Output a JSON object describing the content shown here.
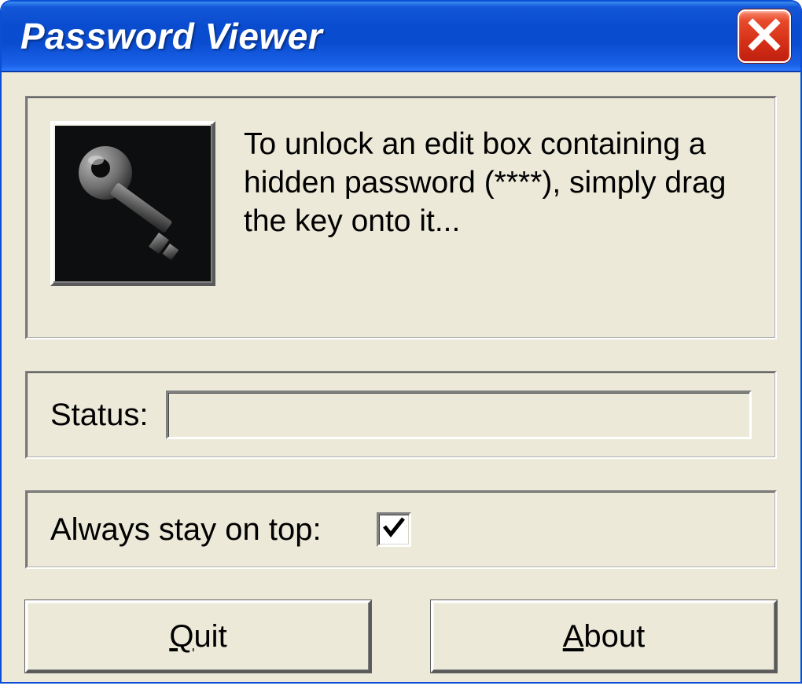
{
  "window": {
    "title": "Password Viewer"
  },
  "instruction": {
    "text": "To unlock an edit box containing a hidden password (****), simply drag the key onto it..."
  },
  "status": {
    "label": "Status:",
    "value": ""
  },
  "ontop": {
    "label": "Always stay on top:",
    "checked": true
  },
  "buttons": {
    "quit": {
      "prefix": "Q",
      "rest": "uit"
    },
    "about": {
      "prefix": "A",
      "rest": "bout"
    }
  },
  "icons": {
    "close": "close-icon",
    "key": "key-icon",
    "checkmark": "checkmark-icon"
  }
}
